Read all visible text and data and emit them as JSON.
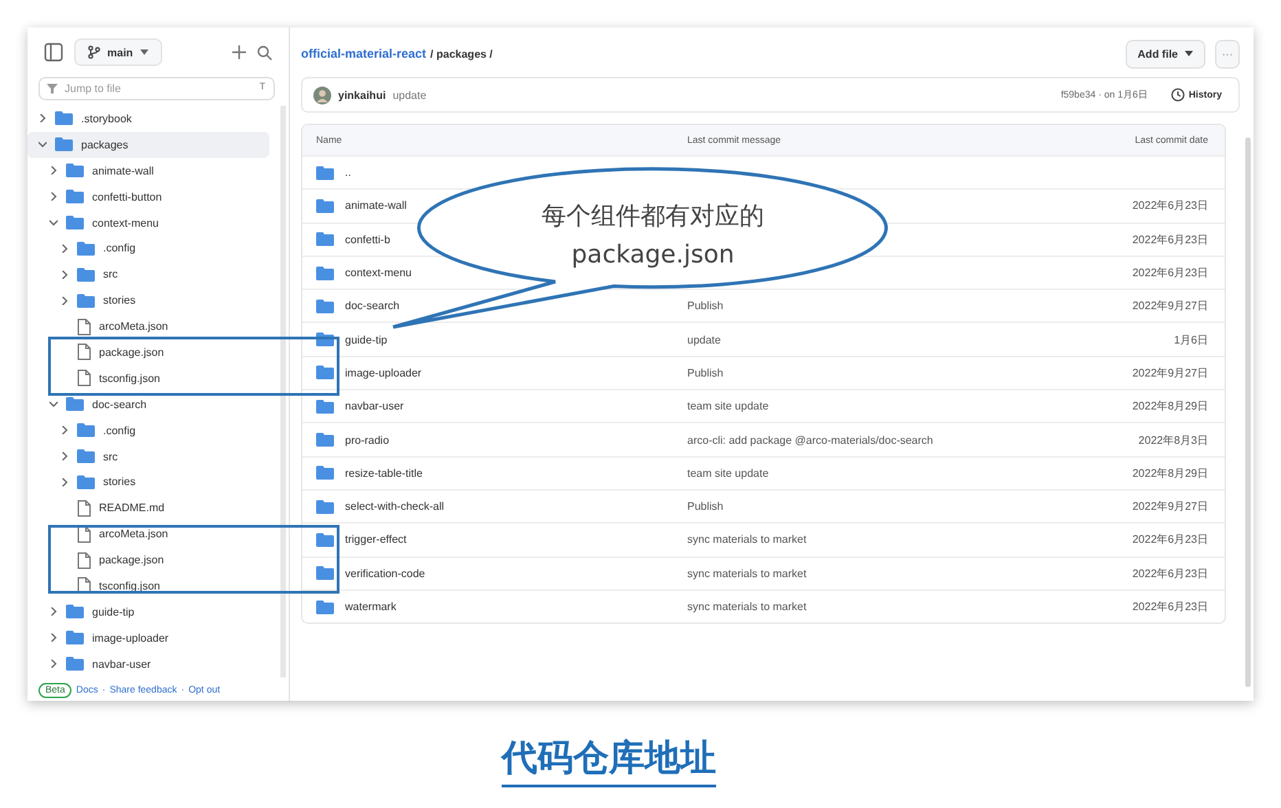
{
  "sidebar": {
    "branch": "main",
    "search": {
      "placeholder": "Jump to file",
      "shortcut": "T"
    },
    "tree": [
      {
        "name": ".storybook",
        "kind": "folder",
        "expanded": false,
        "selected": false
      },
      {
        "name": "packages",
        "kind": "folder",
        "expanded": true,
        "selected": true,
        "children": [
          {
            "name": "animate-wall",
            "kind": "folder",
            "expanded": false,
            "selected": false
          },
          {
            "name": "confetti-button",
            "kind": "folder",
            "expanded": false,
            "selected": false
          },
          {
            "name": "context-menu",
            "kind": "folder",
            "expanded": true,
            "selected": false,
            "children": [
              {
                "name": ".config",
                "kind": "folder",
                "expanded": false,
                "selected": false
              },
              {
                "name": "src",
                "kind": "folder",
                "expanded": false,
                "selected": false
              },
              {
                "name": "stories",
                "kind": "folder",
                "expanded": false,
                "selected": false
              },
              {
                "name": "arcoMeta.json",
                "kind": "file",
                "selected": false
              },
              {
                "name": "package.json",
                "kind": "file",
                "selected": false
              },
              {
                "name": "tsconfig.json",
                "kind": "file",
                "selected": false
              }
            ]
          },
          {
            "name": "doc-search",
            "kind": "folder",
            "expanded": true,
            "selected": false,
            "children": [
              {
                "name": ".config",
                "kind": "folder",
                "expanded": false,
                "selected": false
              },
              {
                "name": "src",
                "kind": "folder",
                "expanded": false,
                "selected": false
              },
              {
                "name": "stories",
                "kind": "folder",
                "expanded": false,
                "selected": false
              },
              {
                "name": "README.md",
                "kind": "file",
                "selected": false
              },
              {
                "name": "arcoMeta.json",
                "kind": "file",
                "selected": false
              },
              {
                "name": "package.json",
                "kind": "file",
                "selected": false
              },
              {
                "name": "tsconfig.json",
                "kind": "file",
                "selected": false
              }
            ]
          },
          {
            "name": "guide-tip",
            "kind": "folder",
            "expanded": false,
            "selected": false
          },
          {
            "name": "image-uploader",
            "kind": "folder",
            "expanded": false,
            "selected": false
          },
          {
            "name": "navbar-user",
            "kind": "folder",
            "expanded": false,
            "selected": false
          }
        ]
      }
    ],
    "footer": {
      "badge": "Beta",
      "links": [
        "Docs",
        "Share feedback",
        "Opt out"
      ],
      "separator": "·"
    }
  },
  "breadcrumb": {
    "repo": "official-material-react",
    "path": "/ packages /"
  },
  "add_file_button": "Add file",
  "more_button": "···",
  "commit": {
    "author": "yinkaihui",
    "message": "update",
    "hash_date": "f59be34 · on 1月6日",
    "history": "History"
  },
  "table": {
    "columns": [
      "Name",
      "Last commit message",
      "Last commit date"
    ],
    "rows": [
      {
        "name": ".."
      },
      {
        "name": "animate-wall",
        "date": "2022年6月23日"
      },
      {
        "name": "confetti-b",
        "date": "2022年6月23日"
      },
      {
        "name": "context-menu",
        "date": "2022年6月23日"
      },
      {
        "name": "doc-search",
        "message": "Publish",
        "date": "2022年9月27日"
      },
      {
        "name": "guide-tip",
        "message": "update",
        "date": "1月6日"
      },
      {
        "name": "image-uploader",
        "message": "Publish",
        "date": "2022年9月27日"
      },
      {
        "name": "navbar-user",
        "message": "team site update",
        "date": "2022年8月29日"
      },
      {
        "name": "pro-radio",
        "message": "arco-cli: add package @arco-materials/doc-search",
        "date": "2022年8月3日"
      },
      {
        "name": "resize-table-title",
        "message": "team site update",
        "date": "2022年8月29日"
      },
      {
        "name": "select-with-check-all",
        "message": "Publish",
        "date": "2022年9月27日"
      },
      {
        "name": "trigger-effect",
        "message": "sync materials to market",
        "date": "2022年6月23日"
      },
      {
        "name": "verification-code",
        "message": "sync materials to market",
        "date": "2022年6月23日"
      },
      {
        "name": "watermark",
        "message": "sync materials to market",
        "date": "2022年6月23日"
      }
    ]
  },
  "callout": {
    "lines": [
      "每个组件都有对应的",
      "package.json"
    ]
  },
  "caption": "代码仓库地址"
}
